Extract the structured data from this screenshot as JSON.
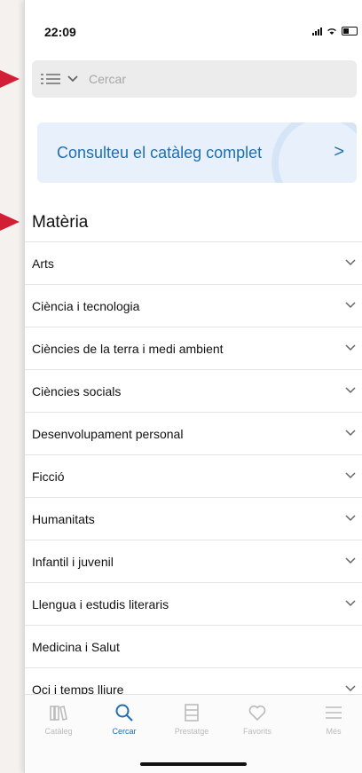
{
  "status_bar": {
    "time": "22:09"
  },
  "search": {
    "placeholder": "Cercar"
  },
  "banner": {
    "label": "Consulteu el catàleg complet",
    "chevron": ">"
  },
  "section": {
    "title": "Matèria"
  },
  "items": [
    {
      "label": "Arts",
      "chevron": true
    },
    {
      "label": "Ciència i tecnologia",
      "chevron": true
    },
    {
      "label": "Ciències de la terra i medi ambient",
      "chevron": true
    },
    {
      "label": "Ciències socials",
      "chevron": true
    },
    {
      "label": "Desenvolupament personal",
      "chevron": true
    },
    {
      "label": "Ficció",
      "chevron": true
    },
    {
      "label": "Humanitats",
      "chevron": true
    },
    {
      "label": "Infantil i juvenil",
      "chevron": true
    },
    {
      "label": "Llengua i estudis literaris",
      "chevron": true
    },
    {
      "label": "Medicina i Salut",
      "chevron": false
    },
    {
      "label": "Oci i temps lliure",
      "chevron": true
    }
  ],
  "tabs": [
    {
      "label": "Catàleg",
      "icon": "library-icon",
      "active": false
    },
    {
      "label": "Cercar",
      "icon": "search-icon",
      "active": true
    },
    {
      "label": "Prestatge",
      "icon": "shelf-icon",
      "active": false
    },
    {
      "label": "Favorits",
      "icon": "heart-icon",
      "active": false
    },
    {
      "label": "Més",
      "icon": "menu-icon",
      "active": false
    }
  ],
  "colors": {
    "accent": "#1f6fb2",
    "annotation_arrow": "#d31f36",
    "banner_bg": "#e8f1fb"
  }
}
